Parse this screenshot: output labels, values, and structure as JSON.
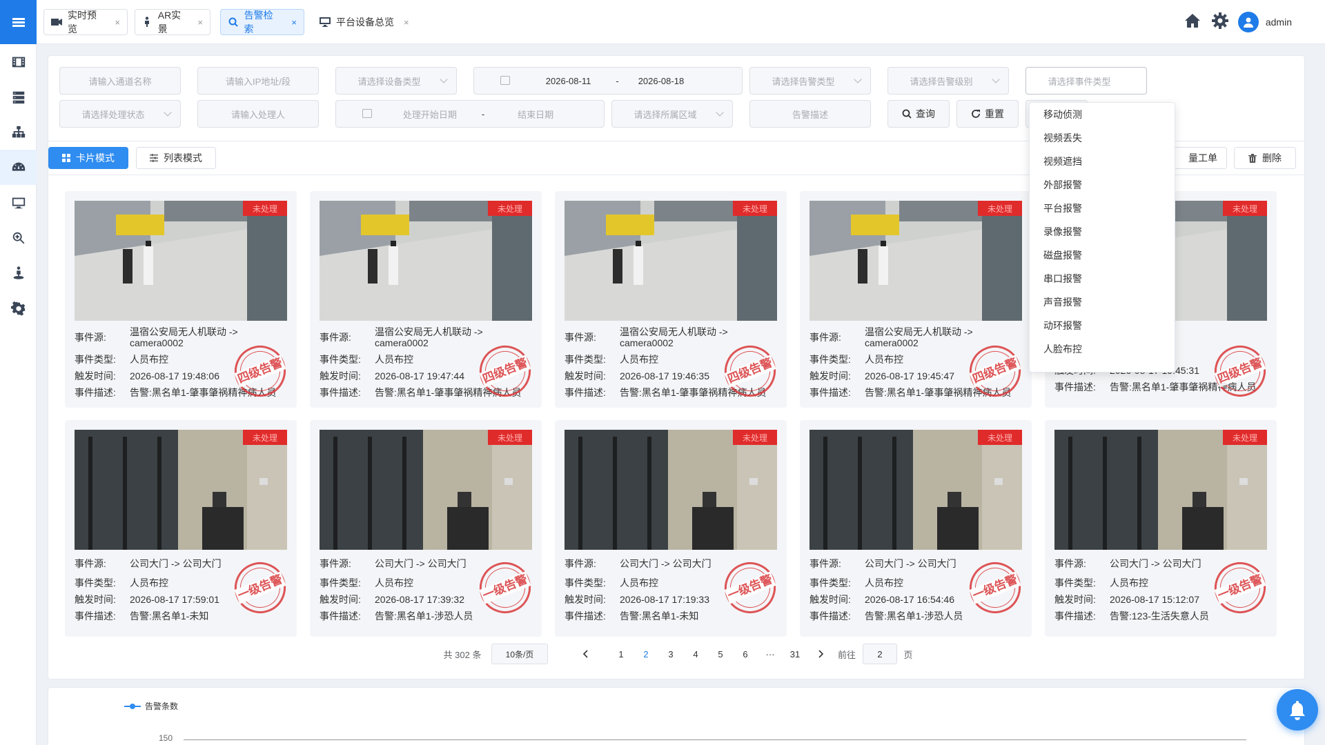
{
  "tabs": [
    {
      "label": "实时预览",
      "icon": "video-camera-icon",
      "close": "×"
    },
    {
      "label": "AR实景",
      "icon": "street-view-icon",
      "close": "×"
    },
    {
      "label": "告警检索",
      "icon": "search-icon",
      "close": "×"
    },
    {
      "label": "平台设备总览",
      "icon": "monitor-icon",
      "close": "×"
    }
  ],
  "user": {
    "name": "admin"
  },
  "sidebar": [
    "film-icon",
    "server-icon",
    "org-tree-icon",
    "dashboard-icon",
    "monitor-icon",
    "zoom-icon",
    "street-view-icon",
    "gear-icon"
  ],
  "filters": {
    "channel": "请输入通道名称",
    "ip": "请输入IP地址/段",
    "device_type": "请选择设备类型",
    "date_start": "2026-08-11",
    "date_sep": "-",
    "date_end": "2026-08-18",
    "alarm_type": "请选择告警类型",
    "alarm_level": "请选择告警级别",
    "event_type": "请选择事件类型",
    "handle_status": "请选择处理状态",
    "handler": "请输入处理人",
    "handle_start": "处理开始日期",
    "handle_sep": "-",
    "handle_end": "结束日期",
    "region": "请选择所属区域",
    "description": "告警描述",
    "query_btn": "查询",
    "reset_btn": "重置"
  },
  "modes": {
    "card": "卡片模式",
    "list": "列表模式"
  },
  "actions": {
    "batch_order": "量工单",
    "delete": "删除"
  },
  "labels": {
    "source": "事件源:",
    "type": "事件类型:",
    "time": "触发时间:",
    "desc": "事件描述:"
  },
  "cards": [
    {
      "status": "未处理",
      "source_line1": "温宿公安局无人机联动 ->",
      "source_line2": "camera0002",
      "type": "人员布控",
      "time": "2026-08-17 19:48:06",
      "desc": "告警:黑名单1-肇事肇祸精神病人员",
      "level": "四级告警",
      "scene": "outdoor"
    },
    {
      "status": "未处理",
      "source_line1": "温宿公安局无人机联动 ->",
      "source_line2": "camera0002",
      "type": "人员布控",
      "time": "2026-08-17 19:47:44",
      "desc": "告警:黑名单1-肇事肇祸精神病人员",
      "level": "四级告警",
      "scene": "outdoor"
    },
    {
      "status": "未处理",
      "source_line1": "温宿公安局无人机联动 ->",
      "source_line2": "camera0002",
      "type": "人员布控",
      "time": "2026-08-17 19:46:35",
      "desc": "告警:黑名单1-肇事肇祸精神病人员",
      "level": "四级告警",
      "scene": "outdoor"
    },
    {
      "status": "未处理",
      "source_line1": "温宿公安局无人机联动 ->",
      "source_line2": "camera0002",
      "type": "人员布控",
      "time": "2026-08-17 19:45:47",
      "desc": "告警:黑名单1-肇事肇祸精神病人员",
      "level": "四级告警",
      "scene": "outdoor"
    },
    {
      "status": "未处理",
      "source_line1": "联动 ->",
      "source_line2": "",
      "type": "人员布控",
      "time": "2026-08-17 19:45:31",
      "desc": "告警:黑名单1-肇事肇祸精神病人员",
      "level": "四级告警",
      "scene": "outdoor"
    },
    {
      "status": "未处理",
      "source_line1": "公司大门 -> 公司大门",
      "source_line2": "",
      "type": "人员布控",
      "time": "2026-08-17 17:59:01",
      "desc": "告警:黑名单1-未知",
      "level": "一级告警",
      "scene": "indoor"
    },
    {
      "status": "未处理",
      "source_line1": "公司大门 -> 公司大门",
      "source_line2": "",
      "type": "人员布控",
      "time": "2026-08-17 17:39:32",
      "desc": "告警:黑名单1-涉恐人员",
      "level": "一级告警",
      "scene": "indoor"
    },
    {
      "status": "未处理",
      "source_line1": "公司大门 -> 公司大门",
      "source_line2": "",
      "type": "人员布控",
      "time": "2026-08-17 17:19:33",
      "desc": "告警:黑名单1-未知",
      "level": "一级告警",
      "scene": "indoor"
    },
    {
      "status": "未处理",
      "source_line1": "公司大门 -> 公司大门",
      "source_line2": "",
      "type": "人员布控",
      "time": "2026-08-17 16:54:46",
      "desc": "告警:黑名单1-涉恐人员",
      "level": "一级告警",
      "scene": "indoor"
    },
    {
      "status": "未处理",
      "source_line1": "公司大门 -> 公司大门",
      "source_line2": "",
      "type": "人员布控",
      "time": "2026-08-17 15:12:07",
      "desc": "告警:123-生活失意人员",
      "level": "一级告警",
      "scene": "indoor"
    }
  ],
  "pagination": {
    "total": "共 302 条",
    "page_size": "10条/页",
    "pages": [
      "1",
      "2",
      "3",
      "4",
      "5",
      "6",
      "···",
      "31"
    ],
    "current": "2",
    "goto_label": "前往",
    "goto_value": "2",
    "page_suffix": "页"
  },
  "dropdown": {
    "items": [
      "移动侦测",
      "视频丢失",
      "视频遮挡",
      "外部报警",
      "平台报警",
      "录像报警",
      "磁盘报警",
      "串口报警",
      "声音报警",
      "动环报警",
      "人脸布控"
    ]
  },
  "chart": {
    "legend": "告警条数",
    "y_tick": "150"
  },
  "colors": {
    "primary": "#1e7be8",
    "danger": "#e02b2b",
    "stamp": "#d9383a"
  }
}
